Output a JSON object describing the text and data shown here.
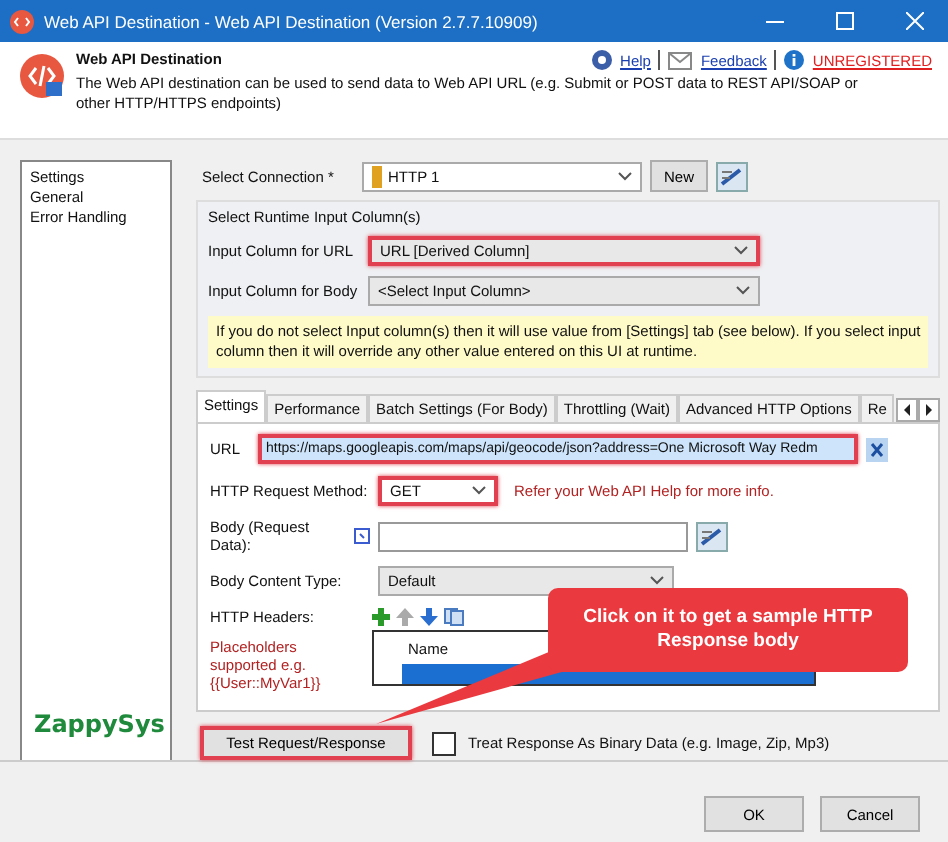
{
  "window": {
    "title": "Web API Destination - Web API Destination (Version 2.7.7.10909)"
  },
  "header": {
    "title": "Web API Destination",
    "description": "The Web API destination can be used to send data to Web API URL (e.g. Submit or POST data to REST API/SOAP or other HTTP/HTTPS endpoints)",
    "links": [
      {
        "kind": "help",
        "label": "Help"
      },
      {
        "kind": "feedback",
        "label": "Feedback"
      },
      {
        "kind": "unregistered",
        "label": "UNREGISTERED"
      }
    ]
  },
  "sidebar": {
    "items": [
      {
        "label": "Settings",
        "selected": false
      },
      {
        "label": "General",
        "selected": false
      },
      {
        "label": "Error Handling",
        "selected": false
      }
    ],
    "logo": "ZappySys"
  },
  "connection": {
    "label": "Select Connection *",
    "value": "HTTP 1",
    "new_button": "New"
  },
  "runtime": {
    "title": "Select Runtime Input Column(s)",
    "fields": [
      {
        "label": "Input Column for URL",
        "value": "URL [Derived Column]",
        "highlighted": true
      },
      {
        "label": "Input Column for Body",
        "value": "<Select Input Column>",
        "highlighted": false
      }
    ],
    "note": "If you do not select Input column(s) then it will use value from [Settings] tab (see below). If you select input column then it will override any other value entered on this UI at runtime."
  },
  "tabs": [
    {
      "label": "Settings",
      "selected": true
    },
    {
      "label": "Performance",
      "selected": false
    },
    {
      "label": "Batch Settings (For Body)",
      "selected": false
    },
    {
      "label": "Throttling (Wait)",
      "selected": false
    },
    {
      "label": "Advanced HTTP Options",
      "selected": false
    },
    {
      "label": "Re",
      "selected": false
    }
  ],
  "url": {
    "label": "URL",
    "value": "https://maps.googleapis.com/maps/api/geocode/json?address=One Microsoft Way Redm",
    "highlighted": true
  },
  "method": {
    "label": "HTTP Request Method:",
    "value": "GET",
    "hint": "Refer your Web API Help for more info.",
    "highlighted": true
  },
  "body": {
    "label": "Body (Request Data):"
  },
  "content_type": {
    "label": "Body Content Type:",
    "value": "Default"
  },
  "headers": {
    "label": "HTTP Headers:",
    "hint": "Placeholders supported e.g. {{User::MyVar1}}",
    "columns": [
      "Name"
    ]
  },
  "callout": "Click on it to get a sample HTTP Response body",
  "test_button": {
    "label": "Test Request/Response",
    "highlighted": true
  },
  "binary": {
    "label": "Treat Response As Binary Data (e.g. Image, Zip, Mp3)",
    "checked": false
  },
  "buttons": [
    "OK",
    "Cancel"
  ]
}
